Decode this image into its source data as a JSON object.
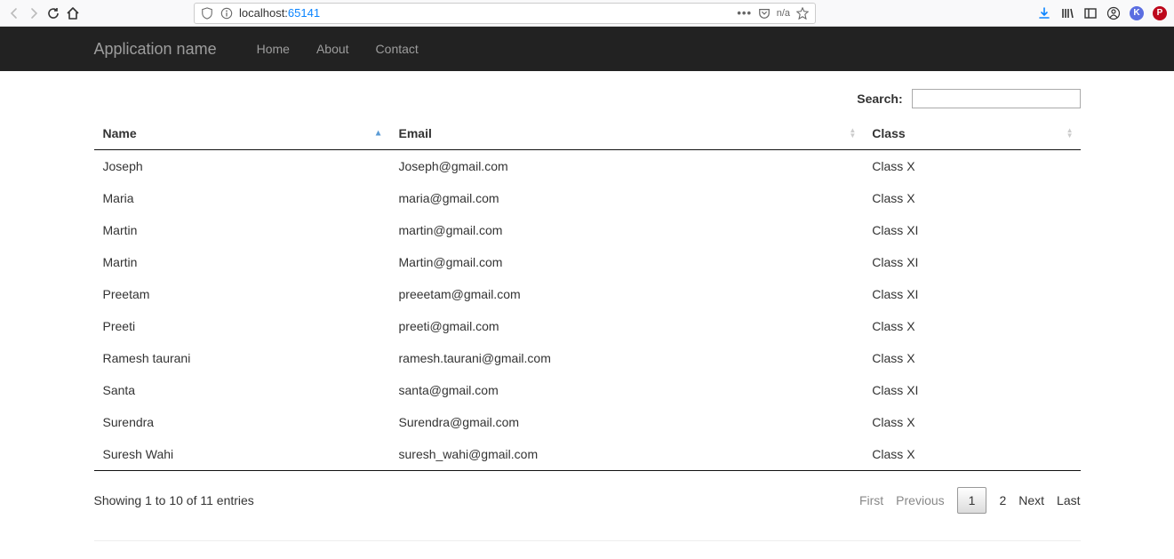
{
  "browser": {
    "url_host": "localhost:",
    "url_port": "65141",
    "tracking": "n/a"
  },
  "navbar": {
    "brand": "Application name",
    "links": [
      "Home",
      "About",
      "Contact"
    ]
  },
  "search": {
    "label": "Search:",
    "value": ""
  },
  "table": {
    "columns": [
      "Name",
      "Email",
      "Class"
    ],
    "rows": [
      {
        "name": "Joseph",
        "email": "Joseph@gmail.com",
        "class": "Class X"
      },
      {
        "name": "Maria",
        "email": "maria@gmail.com",
        "class": "Class X"
      },
      {
        "name": "Martin",
        "email": "martin@gmail.com",
        "class": "Class XI"
      },
      {
        "name": "Martin",
        "email": "Martin@gmail.com",
        "class": "Class XI"
      },
      {
        "name": "Preetam",
        "email": "preeetam@gmail.com",
        "class": "Class XI"
      },
      {
        "name": "Preeti",
        "email": "preeti@gmail.com",
        "class": "Class X"
      },
      {
        "name": "Ramesh taurani",
        "email": "ramesh.taurani@gmail.com",
        "class": "Class X"
      },
      {
        "name": "Santa",
        "email": "santa@gmail.com",
        "class": "Class XI"
      },
      {
        "name": "Surendra",
        "email": "Surendra@gmail.com",
        "class": "Class X"
      },
      {
        "name": "Suresh Wahi",
        "email": "suresh_wahi@gmail.com",
        "class": "Class X"
      }
    ]
  },
  "info": "Showing 1 to 10 of 11 entries",
  "pagination": {
    "first": "First",
    "previous": "Previous",
    "pages": [
      "1",
      "2"
    ],
    "current": "1",
    "next": "Next",
    "last": "Last"
  }
}
